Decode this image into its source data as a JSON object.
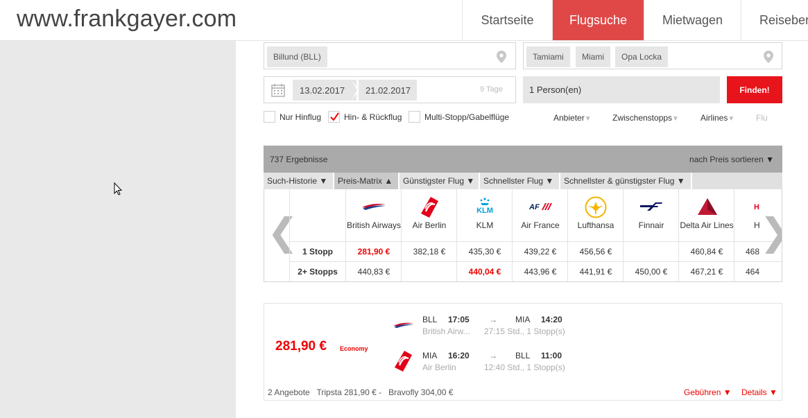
{
  "header": {
    "site_title": "www.frankgayer.com",
    "nav": [
      {
        "label": "Startseite"
      },
      {
        "label": "Flugsuche"
      },
      {
        "label": "Mietwagen"
      },
      {
        "label": "Reiseberi"
      }
    ]
  },
  "search": {
    "origin_chip": "Billund (BLL)",
    "destination_chips": [
      "Tamiami",
      "Miami",
      "Opa Locka"
    ],
    "date_from": "13.02.2017",
    "date_to": "21.02.2017",
    "duration": "9 Tage",
    "persons": "1 Person(en)",
    "find_button": "Finden!",
    "trip_types": [
      {
        "label": "Nur Hinflug",
        "checked": false
      },
      {
        "label": "Hin- & Rückflug",
        "checked": true
      },
      {
        "label": "Multi-Stopp/Gabelflüge",
        "checked": false
      }
    ],
    "filters": [
      "Anbieter",
      "Zwischenstopps",
      "Airlines",
      "Flu"
    ]
  },
  "results": {
    "count": "737 Ergebnisse",
    "sort": "nach Preis sortieren",
    "sort_arrow": "▼",
    "tabs": [
      {
        "label": "Such-Historie ▼"
      },
      {
        "label": "Preis-Matrix ▲"
      },
      {
        "label": "Günstigster Flug ▼"
      },
      {
        "label": "Schnellster Flug ▼"
      },
      {
        "label": "Schnellster & günstigster Flug ▼"
      }
    ]
  },
  "matrix": {
    "row_labels": [
      "1 Stopp",
      "2+ Stopps"
    ],
    "airlines": [
      {
        "name": "British Airways",
        "stop1": "281,90 €",
        "stop2": "440,83 €",
        "red1": true,
        "red2": false
      },
      {
        "name": "Air Berlin",
        "stop1": "382,18 €",
        "stop2": "",
        "red1": false,
        "red2": false
      },
      {
        "name": "KLM",
        "stop1": "435,30 €",
        "stop2": "440,04 €",
        "red1": false,
        "red2": true
      },
      {
        "name": "Air France",
        "stop1": "439,22 €",
        "stop2": "443,96 €",
        "red1": false,
        "red2": false
      },
      {
        "name": "Lufthansa",
        "stop1": "456,56 €",
        "stop2": "441,91 €",
        "red1": false,
        "red2": false
      },
      {
        "name": "Finnair",
        "stop1": "",
        "stop2": "450,00 €",
        "red1": false,
        "red2": false
      },
      {
        "name": "Delta Air Lines",
        "stop1": "460,84 €",
        "stop2": "467,21 €",
        "red1": false,
        "red2": false
      },
      {
        "name": "H",
        "stop1": "468",
        "stop2": "464",
        "red1": false,
        "red2": false
      }
    ],
    "prev_arrow": "❮",
    "next_arrow": "❯"
  },
  "offer": {
    "price": "281,90 €",
    "class": "Economy",
    "outbound": {
      "from": "BLL",
      "dep": "17:05",
      "arrow": "→",
      "to": "MIA",
      "arr": "14:20",
      "airline": "British Airw...",
      "info": "27:15 Std., 1 Stopp(s)"
    },
    "inbound": {
      "from": "MIA",
      "dep": "16:20",
      "arrow": "→",
      "to": "BLL",
      "arr": "11:00",
      "airline": "Air Berlin",
      "info": "12:40 Std., 1 Stopp(s)"
    },
    "footer": "2 Angebote   Tripsta 281,90 € -   Bravofly 304,00 €",
    "fees": "Gebühren ▼",
    "details": "Details ▼"
  },
  "colors": {
    "accent": "#e04848",
    "button": "#e8141b",
    "price": "#ee0000"
  }
}
